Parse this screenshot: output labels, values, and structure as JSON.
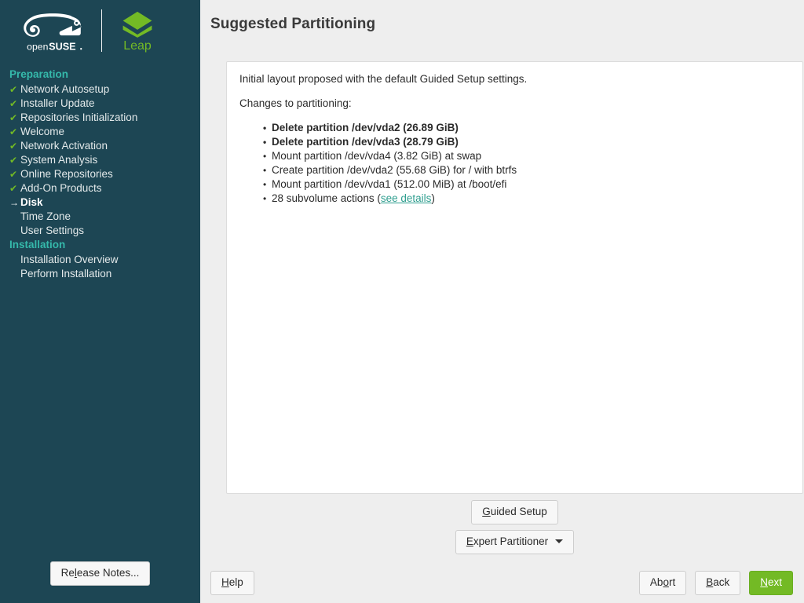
{
  "branding": {
    "logo_alt": "openSUSE",
    "logo_wordmark_open": "open",
    "logo_wordmark_suse": "SUSE",
    "product_name": "Leap"
  },
  "sidebar": {
    "sections": [
      {
        "name": "Preparation",
        "items": [
          {
            "label": "Network Autosetup",
            "state": "done",
            "marker": "✔"
          },
          {
            "label": "Installer Update",
            "state": "done",
            "marker": "✔"
          },
          {
            "label": "Repositories Initialization",
            "state": "done",
            "marker": "✔"
          },
          {
            "label": "Welcome",
            "state": "done",
            "marker": "✔"
          },
          {
            "label": "Network Activation",
            "state": "done",
            "marker": "✔"
          },
          {
            "label": "System Analysis",
            "state": "done",
            "marker": "✔"
          },
          {
            "label": "Online Repositories",
            "state": "done",
            "marker": "✔"
          },
          {
            "label": "Add-On Products",
            "state": "done",
            "marker": "✔"
          },
          {
            "label": "Disk",
            "state": "current",
            "marker": "→"
          },
          {
            "label": "Time Zone",
            "state": "pending",
            "marker": ""
          },
          {
            "label": "User Settings",
            "state": "pending",
            "marker": ""
          }
        ]
      },
      {
        "name": "Installation",
        "items": [
          {
            "label": "Installation Overview",
            "state": "pending",
            "marker": ""
          },
          {
            "label": "Perform Installation",
            "state": "pending",
            "marker": ""
          }
        ]
      }
    ],
    "release_notes_button": {
      "accel": "R",
      "accel_letter": "l",
      "prefix": "Re",
      "suffix": "ease Notes..."
    }
  },
  "header": {
    "title": "Suggested Partitioning"
  },
  "content": {
    "intro": "Initial layout proposed with the default Guided Setup settings.",
    "changes_label": "Changes to partitioning:",
    "actions": [
      {
        "text": "Delete partition /dev/vda2 (26.89 GiB)",
        "bold": true
      },
      {
        "text": "Delete partition /dev/vda3 (28.79 GiB)",
        "bold": true
      },
      {
        "text": "Mount partition /dev/vda4 (3.82 GiB) at swap",
        "bold": false
      },
      {
        "text": "Create partition /dev/vda2 (55.68 GiB) for / with btrfs",
        "bold": false
      },
      {
        "text": "Mount partition /dev/vda1 (512.00 MiB) at /boot/efi",
        "bold": false
      }
    ],
    "subvolume_action": {
      "prefix": "28 subvolume actions (",
      "link_text": "see details",
      "suffix": ")"
    }
  },
  "mid_buttons": {
    "guided_setup": {
      "prefix": "",
      "accel_letter": "G",
      "suffix": "uided Setup"
    },
    "expert_partitioner": {
      "prefix": "",
      "accel_letter": "E",
      "suffix": "xpert Partitioner"
    }
  },
  "bottom_bar": {
    "help": {
      "prefix": "",
      "accel_letter": "H",
      "suffix": "elp"
    },
    "abort": {
      "prefix": "Ab",
      "accel_letter": "o",
      "suffix": "rt"
    },
    "back": {
      "prefix": "",
      "accel_letter": "B",
      "suffix": "ack"
    },
    "next": {
      "prefix": "",
      "accel_letter": "N",
      "suffix": "ext"
    }
  },
  "colors": {
    "sidebar_bg": "#1d4654",
    "section_heading": "#35b9ab",
    "accent_green": "#73ba25",
    "link_teal": "#2f9e8f",
    "main_bg": "#eeeeee",
    "panel_bg": "#ffffff"
  }
}
